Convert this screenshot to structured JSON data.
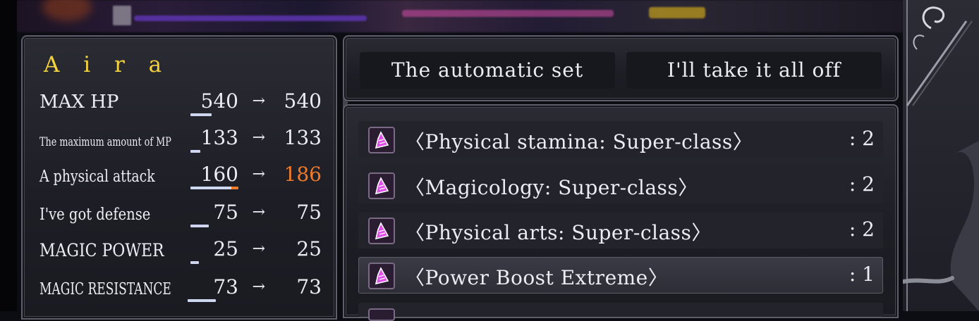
{
  "character": {
    "name": "A i r a"
  },
  "stats": [
    {
      "label": "MAX HP",
      "old": "540",
      "arrow": "→",
      "new": "540",
      "up": false,
      "bar": 0.42
    },
    {
      "label": "The maximum amount of MP",
      "old": "133",
      "arrow": "→",
      "new": "133",
      "up": false,
      "bar": 0.2
    },
    {
      "label": "A physical attack",
      "old": "160",
      "arrow": "→",
      "new": "186",
      "up": true,
      "bar": 0.95
    },
    {
      "label": "I've got defense",
      "old": "75",
      "arrow": "→",
      "new": "75",
      "up": false,
      "bar": 0.35
    },
    {
      "label": "MAGIC POWER",
      "old": "25",
      "arrow": "→",
      "new": "25",
      "up": false,
      "bar": 0.12
    },
    {
      "label": "MAGIC RESISTANCE",
      "old": "73",
      "arrow": "→",
      "new": "73",
      "up": false,
      "bar": 0.4
    }
  ],
  "buttons": {
    "auto_set": "The automatic set",
    "take_off": "I'll take it all off"
  },
  "skills": [
    {
      "name": "〈Physical stamina: Super-class〉",
      "count": ": 2",
      "icon": "skill-crystal-icon"
    },
    {
      "name": "〈Magicology: Super-class〉",
      "count": ": 2",
      "icon": "skill-crystal-icon"
    },
    {
      "name": "〈Physical arts: Super-class〉",
      "count": ": 2",
      "icon": "skill-crystal-icon"
    },
    {
      "name": "〈Power Boost Extreme〉",
      "count": ": 1",
      "icon": "skill-crystal-icon"
    }
  ],
  "colors": {
    "name_gold": "#f4d23c",
    "increase": "#f07a2a",
    "text": "#ececf2",
    "icon_pink": "#e04fe8"
  }
}
